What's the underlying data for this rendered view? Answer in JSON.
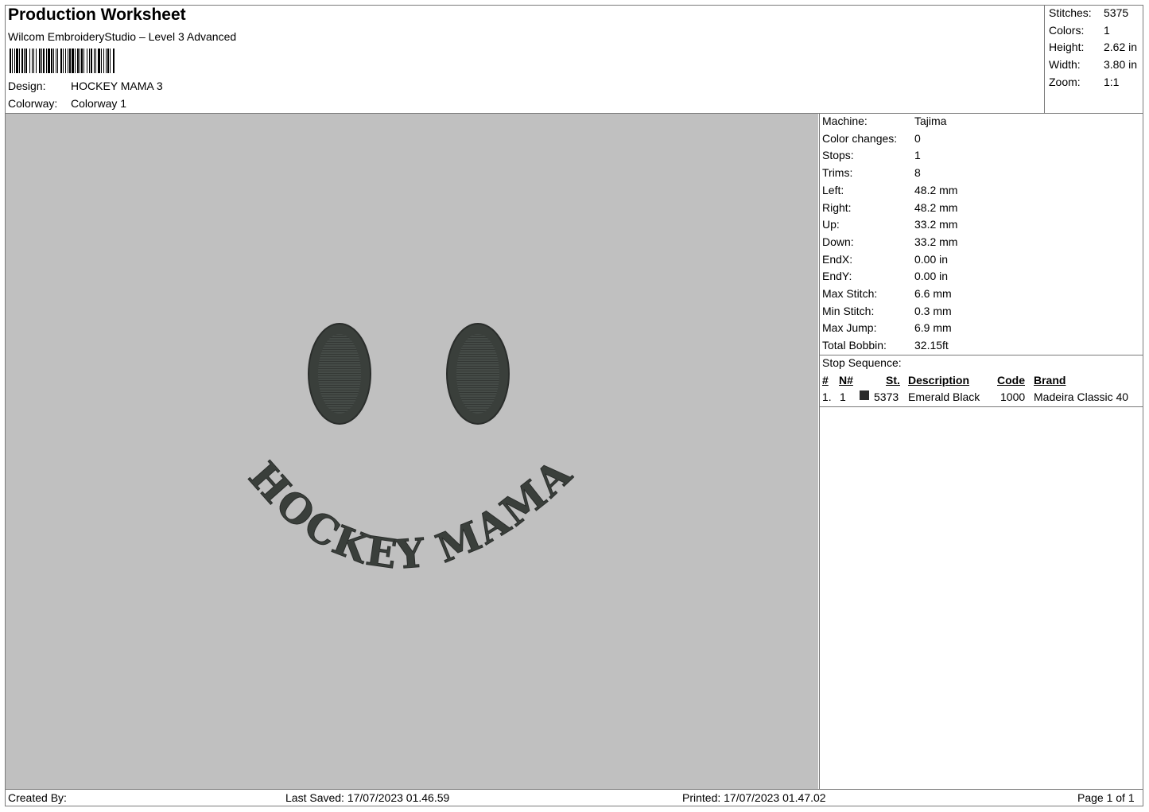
{
  "header": {
    "title": "Production Worksheet",
    "software": "Wilcom EmbroideryStudio – Level 3 Advanced",
    "design_label": "Design:",
    "design_value": "HOCKEY MAMA 3",
    "colorway_label": "Colorway:",
    "colorway_value": "Colorway 1"
  },
  "summary": [
    {
      "label": "Stitches:",
      "value": "5375"
    },
    {
      "label": "Colors:",
      "value": "1"
    },
    {
      "label": "Height:",
      "value": "2.62 in"
    },
    {
      "label": "Width:",
      "value": "3.80 in"
    },
    {
      "label": "Zoom:",
      "value": "1:1"
    }
  ],
  "machine_stats": [
    {
      "label": "Machine:",
      "value": "Tajima"
    },
    {
      "label": "Color changes:",
      "value": "0"
    },
    {
      "label": "Stops:",
      "value": "1"
    },
    {
      "label": "Trims:",
      "value": "8"
    },
    {
      "label": "Left:",
      "value": "48.2 mm"
    },
    {
      "label": "Right:",
      "value": "48.2 mm"
    },
    {
      "label": "Up:",
      "value": "33.2 mm"
    },
    {
      "label": "Down:",
      "value": "33.2 mm"
    },
    {
      "label": "EndX:",
      "value": "0.00 in"
    },
    {
      "label": "EndY:",
      "value": "0.00 in"
    },
    {
      "label": "Max Stitch:",
      "value": "6.6 mm"
    },
    {
      "label": "Min Stitch:",
      "value": "0.3 mm"
    },
    {
      "label": "Max Jump:",
      "value": "6.9 mm"
    },
    {
      "label": "Total Bobbin:",
      "value": "32.15ft"
    }
  ],
  "stop_sequence": {
    "title": "Stop Sequence:",
    "columns": [
      "#",
      "N#",
      "St.",
      "Description",
      "Code",
      "Brand"
    ],
    "rows": [
      {
        "num": "1.",
        "n": "1",
        "color": "#2b2b2b",
        "stitches": "5373",
        "description": "Emerald Black",
        "code": "1000",
        "brand": "Madeira Classic 40"
      }
    ]
  },
  "design": {
    "text": "HOCKEY MAMA",
    "thread_color": "#3a3f3b",
    "background_color": "#c0c0c0"
  },
  "footer": {
    "created_by": "Created By:",
    "last_saved": "Last Saved: 17/07/2023 01.46.59",
    "printed": "Printed: 17/07/2023 01.47.02",
    "page": "Page 1 of 1"
  }
}
